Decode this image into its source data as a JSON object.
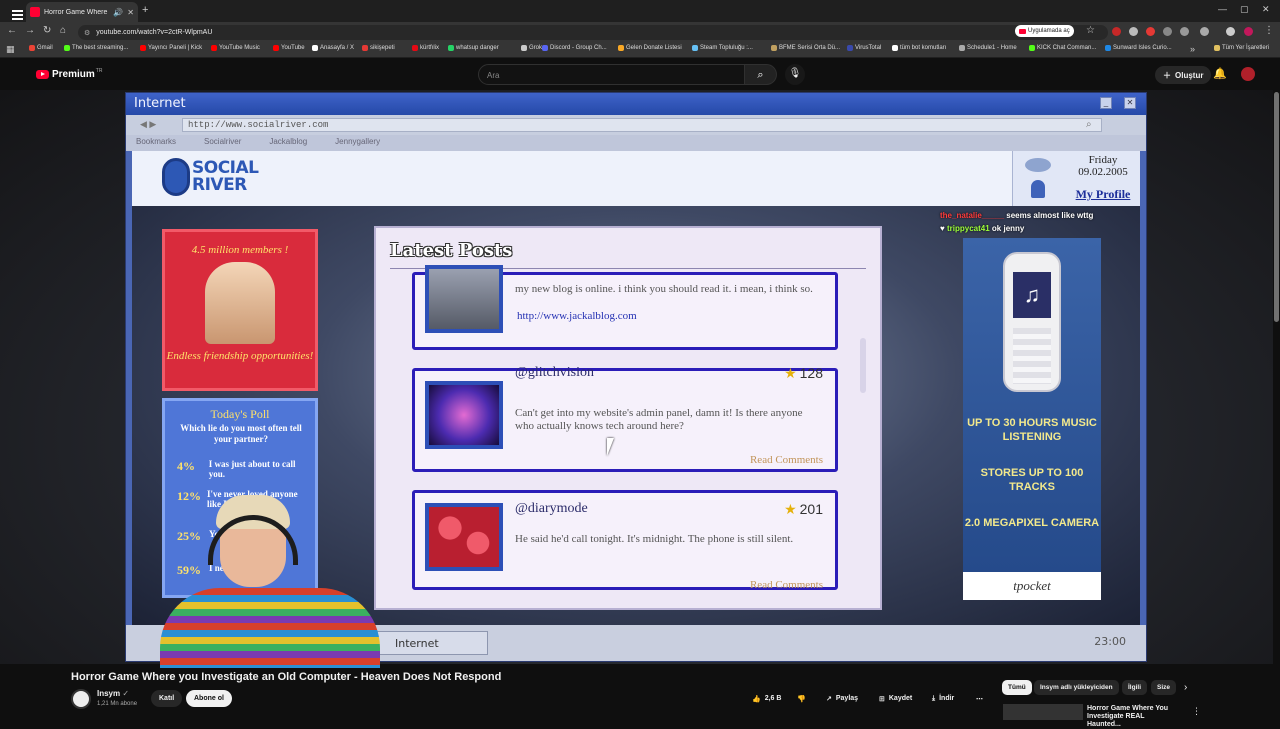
{
  "browser": {
    "tab_title": "Horror Game Where you Investigate an Old Computer - Heaven Does Not Respond",
    "url": "youtube.com/watch?v=2ctR-WlpmAU",
    "open_in_app": "Uygulamada aç",
    "all_bookmarks": "Tüm Yer İşaretleri",
    "bookmarks": [
      "Gmail",
      "The best streaming...",
      "Yayıncı Paneli | Kick",
      "YouTube Music",
      "YouTube",
      "Anasayfa / X",
      "sikişepeti",
      "kürtfılix",
      "whatsup danger",
      "Grok",
      "Discord - Group Ch...",
      "Gelen Donate Listesi",
      "Steam Topluluğu :...",
      "BFME Serisi Orta Dü...",
      "VirusTotal",
      "tüm bot komutları",
      "Schedule1 - Home",
      "KICK Chat Comman...",
      "Sunward Isles Curio..."
    ]
  },
  "youtube": {
    "brand": "Premium",
    "brand_sup": "TR",
    "search_placeholder": "Ara",
    "create_label": "Oluştur"
  },
  "game": {
    "window_title": "Internet",
    "url": "http://www.socialriver.com",
    "bookmarks": [
      "Bookmarks",
      "Socialriver",
      "Jackalblog",
      "Jennygallery"
    ],
    "site_logo": [
      "SOCIAL",
      "RIVER"
    ],
    "date_day": "Friday",
    "date": "09.02.2005",
    "my_profile": "My Profile",
    "ad_members": "4.5 million members !",
    "ad_friendship": "Endless friendship opportunities!",
    "poll_title": "Today's Poll",
    "poll_question": "Which lie do you most often tell your partner?",
    "poll": [
      {
        "pct": "4%",
        "text": "I was just about to call you."
      },
      {
        "pct": "12%",
        "text": "I've never loved anyone like I love you."
      },
      {
        "pct": "25%",
        "text": "You..."
      },
      {
        "pct": "59%",
        "text": "I ne..."
      }
    ],
    "posts_title": "Latest Posts",
    "posts": [
      {
        "user": "",
        "score": "",
        "body": "my new blog is online. i think you should read it. i mean, i think so.",
        "link": "http://www.jackalblog.com",
        "more": ""
      },
      {
        "user": "@glitchvision",
        "score": "128",
        "body": "Can't get into my website's admin panel, damn it! Is there anyone who actually knows tech around here?",
        "link": "",
        "more": "Read Comments"
      },
      {
        "user": "@diarymode",
        "score": "201",
        "body": "He said he'd call tonight. It's midnight. The phone is still silent.",
        "link": "",
        "more": "Read Comments"
      }
    ],
    "phone_ad": {
      "line1": "UP TO 30 HOURS MUSIC LISTENING",
      "line2": "STORES UP TO 100 TRACKS",
      "line3": "2.0 MEGAPIXEL CAMERA",
      "brand": "tpocket"
    },
    "taskbar_item": "Internet",
    "clock": "23:00"
  },
  "chat": [
    {
      "user": "the_natalie_____",
      "msg": "seems almost like wttg"
    },
    {
      "user": "trippycat41",
      "msg": "ok jenny"
    }
  ],
  "video": {
    "title": "Horror Game Where you Investigate an Old Computer - Heaven Does Not Respond",
    "channel": "Insym",
    "subscribers": "1,21 Mn abone",
    "join": "Katıl",
    "subscribe": "Abone ol",
    "likes": "2,6 B",
    "share": "Paylaş",
    "save": "Kaydet",
    "download": "İndir"
  },
  "chips": [
    "Tümü",
    "Insym adlı yükleyiciden",
    "İlgili",
    "Size"
  ],
  "recommended_title": "Horror Game Where You Investigate REAL Haunted..."
}
